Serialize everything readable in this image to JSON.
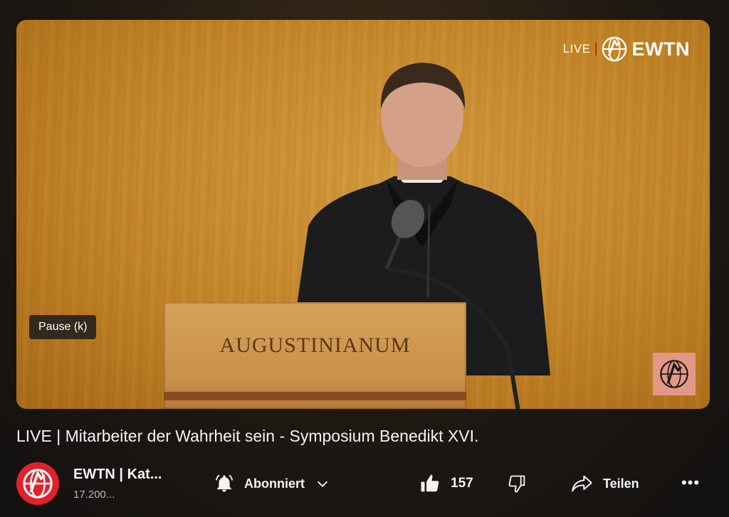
{
  "player": {
    "live_label": "LIVE",
    "brand": "EWTN",
    "pause_tooltip": "Pause (k)",
    "podium_text": "AUGUSTINIANUM",
    "colors": {
      "live_bar": "#e21b1b",
      "corner_badge": "#e39887"
    }
  },
  "video": {
    "title": "LIVE | Mitarbeiter der Wahrheit sein - Symposium Benedikt XVI."
  },
  "channel": {
    "name": "EWTN | Kat...",
    "subscribers": "17.200...",
    "avatar_color": "#e1222a"
  },
  "actions": {
    "subscribe_label": "Abonniert",
    "like_count": "157",
    "share_label": "Teilen",
    "more_label": "•••",
    "icons": [
      "bell-icon",
      "chevron-down-icon",
      "thumbs-up-icon",
      "thumbs-down-icon",
      "share-arrow-icon",
      "more-icon"
    ]
  }
}
